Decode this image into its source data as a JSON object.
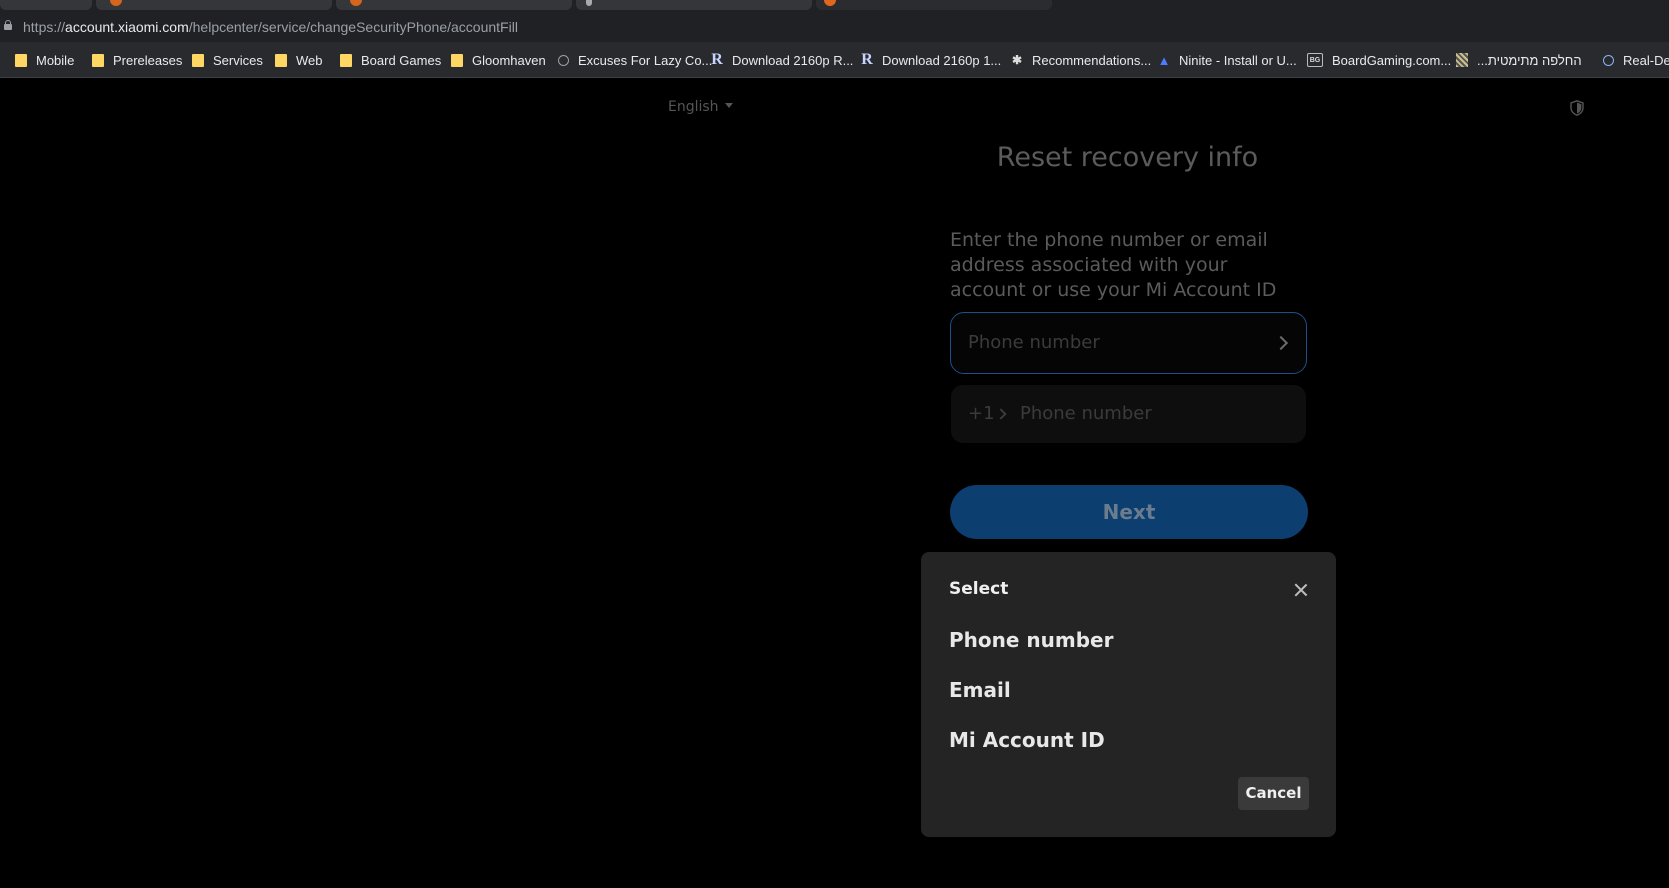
{
  "browser": {
    "url_host": "account.xiaomi.com",
    "url_prefix": "https://",
    "url_path": "/helpcenter/service/changeSecurityPhone/accountFill",
    "bookmarks": [
      {
        "label": "Mobile",
        "icon": "folder-icon"
      },
      {
        "label": "Prereleases",
        "icon": "folder-icon"
      },
      {
        "label": "Services",
        "icon": "folder-icon"
      },
      {
        "label": "Web",
        "icon": "folder-icon"
      },
      {
        "label": "Board Games",
        "icon": "folder-icon"
      },
      {
        "label": "Gloomhaven",
        "icon": "folder-icon"
      },
      {
        "label": "Excuses For Lazy Co...",
        "icon": "globe-icon"
      },
      {
        "label": "Download 2160p R...",
        "icon": "r-logo-icon"
      },
      {
        "label": "Download 2160p 1...",
        "icon": "r-logo-icon"
      },
      {
        "label": "Recommendations...",
        "icon": "spider-icon"
      },
      {
        "label": "Ninite - Install or U...",
        "icon": "ninite-icon"
      },
      {
        "label": "BoardGaming.com...",
        "icon": "bg-icon"
      },
      {
        "label": "...החלפה מתימטית",
        "icon": "pixel-icon"
      },
      {
        "label": "Real-De",
        "icon": "ring-icon"
      }
    ]
  },
  "page": {
    "language": "English",
    "title": "Reset recovery info",
    "description": "Enter the phone number or email address associated with your account or use your Mi Account ID",
    "account_placeholder": "Phone number",
    "country_code": "+1",
    "phone_placeholder": "Phone number",
    "next_label": "Next"
  },
  "dialog": {
    "title": "Select",
    "options": [
      "Phone number",
      "Email",
      "Mi Account ID"
    ],
    "cancel_label": "Cancel"
  },
  "colors": {
    "accent": "#0c3e6f",
    "focus_border": "#1f4f87",
    "dialog_bg": "#242424"
  }
}
